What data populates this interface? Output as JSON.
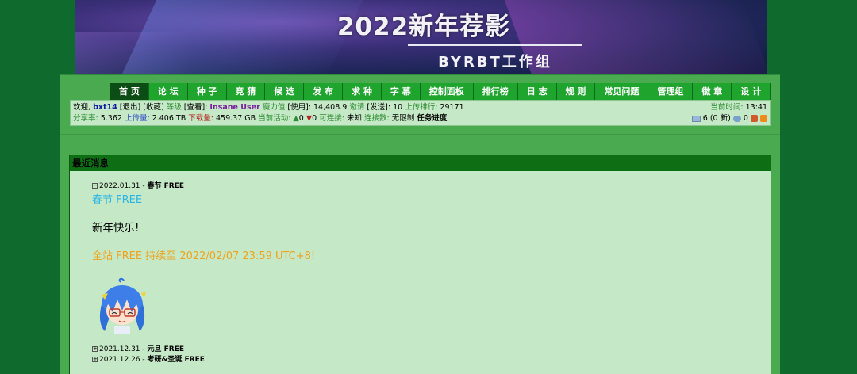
{
  "banner": {
    "title": "2022新年荐影",
    "subtitle": "BYRBT工作组"
  },
  "nav": {
    "items": [
      {
        "label": "首 页",
        "active": true
      },
      {
        "label": "论 坛"
      },
      {
        "label": "种 子"
      },
      {
        "label": "竞 猜"
      },
      {
        "label": "候 选"
      },
      {
        "label": "发 布"
      },
      {
        "label": "求 种"
      },
      {
        "label": "字 幕"
      },
      {
        "label": "控制面板"
      },
      {
        "label": "排行榜"
      },
      {
        "label": "日 志"
      },
      {
        "label": "规 则"
      },
      {
        "label": "常见问题"
      },
      {
        "label": "管理组"
      },
      {
        "label": "徽 章"
      },
      {
        "label": "设 计"
      }
    ]
  },
  "userbar": {
    "welcome": "欢迎,",
    "username": "bxt14",
    "logout": "[退出]",
    "favorites": "[收藏]",
    "level_label": "等级",
    "view": "[查看]:",
    "class": "Insane User",
    "magic_label": "魔力值",
    "use": "[使用]:",
    "magic_value": "14,408.9",
    "invite_label": "邀请",
    "send": "[发送]:",
    "invite_value": "10",
    "upload_rank_label": "上传排行:",
    "upload_rank_value": "29171",
    "current_time_label": "当前时间:",
    "current_time_value": "13:41",
    "ratio_label": "分享率:",
    "ratio_value": "5.362",
    "uploaded_label": "上传量:",
    "uploaded_value": "2.406 TB",
    "downloaded_label": "下载量:",
    "downloaded_value": "459.37 GB",
    "activity_label": "当前活动:",
    "seeding_value": "0",
    "leeching_value": "0",
    "connectable_label": "可连接:",
    "connectable_value": "未知",
    "connections_label": "连接数:",
    "connections_value": "无限制",
    "task_progress": "任务进度",
    "messages_value": "6",
    "messages_new": "(0 新)",
    "views_value": "0"
  },
  "news": {
    "header": "最近消息",
    "entries": [
      {
        "date": "2022.01.31",
        "sep": " - ",
        "title": "春节 FREE",
        "expanded": true
      },
      {
        "date": "2021.12.31",
        "sep": " - ",
        "title": "元旦 FREE"
      },
      {
        "date": "2021.12.26",
        "sep": " - ",
        "title": "考研&圣诞 FREE"
      }
    ],
    "expanded_title": "春节 FREE",
    "body": "新年快乐!",
    "free_notice": "全站 FREE 持续至 2022/02/07 23:59 UTC+8!"
  },
  "colors": {
    "page_bg": "#0f6a2e",
    "frame_bg": "#49aa50",
    "nav_bg": "#1fa52e",
    "nav_active": "#0c4d15",
    "panel_bg": "#c5e8c6",
    "news_title": "#2ab6e6",
    "free_notice": "#f0a21c"
  }
}
